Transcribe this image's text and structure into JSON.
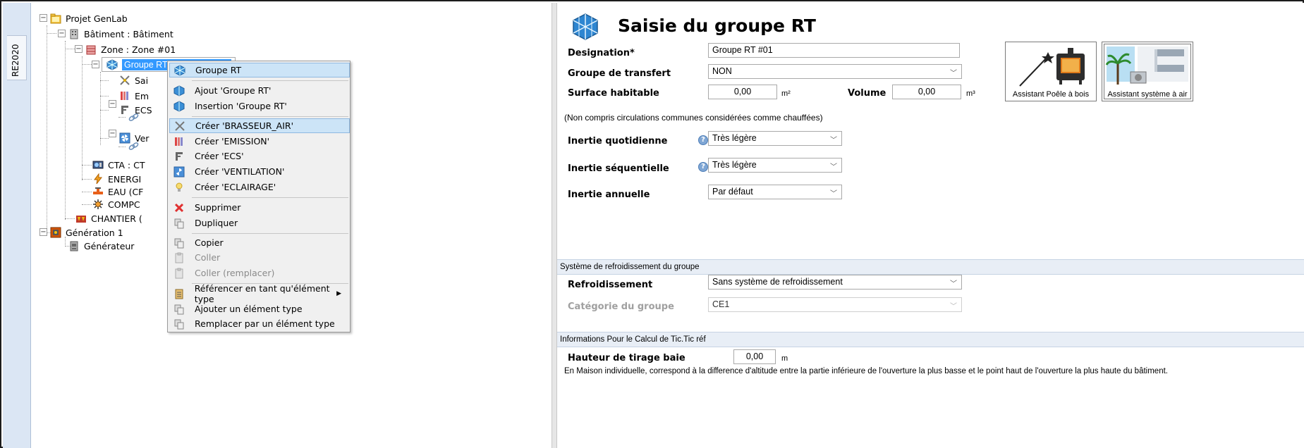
{
  "side_tab": {
    "label": "RE2020"
  },
  "tree": {
    "nodes": [
      {
        "label": "Projet GenLab",
        "icon": "folder-project-icon"
      },
      {
        "label": "Bâtiment : Bâtiment",
        "icon": "building-icon"
      },
      {
        "label": "Zone : Zone #01",
        "icon": "zone-icon"
      },
      {
        "label": "Groupe RT:Groupe RT #01",
        "icon": "groupe-rt-icon"
      },
      {
        "label": "Sai",
        "icon": "brasseur-icon"
      },
      {
        "label": "Em",
        "icon": "emission-icon"
      },
      {
        "label": "ECS",
        "icon": "ecs-icon"
      },
      {
        "label": "Ver",
        "icon": "ventilation-icon"
      },
      {
        "label": "CTA : CT",
        "icon": "cta-icon"
      },
      {
        "label": "ENERGI",
        "icon": "energy-icon"
      },
      {
        "label": "EAU (CF",
        "icon": "water-icon"
      },
      {
        "label": "COMPC",
        "icon": "component-icon"
      },
      {
        "label": "CHANTIER (",
        "icon": "chantier-icon"
      },
      {
        "label": "Génération 1",
        "icon": "generation-icon"
      },
      {
        "label": "Générateur",
        "icon": "generator-icon"
      }
    ]
  },
  "context_menu": {
    "items": [
      {
        "label": "Groupe RT",
        "icon": "groupe-rt-icon"
      },
      {
        "label": "Ajout 'Groupe RT'",
        "icon": "groupe-rt-icon"
      },
      {
        "label": "Insertion 'Groupe RT'",
        "icon": "groupe-rt-icon"
      },
      {
        "label": "Créer 'BRASSEUR_AIR'",
        "icon": "brasseur-icon"
      },
      {
        "label": "Créer 'EMISSION'",
        "icon": "emission-icon"
      },
      {
        "label": "Créer 'ECS'",
        "icon": "ecs-icon"
      },
      {
        "label": "Créer 'VENTILATION'",
        "icon": "ventilation-icon"
      },
      {
        "label": "Créer 'ECLAIRAGE'",
        "icon": "lightbulb-icon"
      },
      {
        "label": "Supprimer",
        "icon": "delete-icon"
      },
      {
        "label": "Dupliquer",
        "icon": "duplicate-icon"
      },
      {
        "label": "Copier",
        "icon": "copy-icon"
      },
      {
        "label": "Coller",
        "icon": "paste-icon"
      },
      {
        "label": "Coller (remplacer)",
        "icon": "paste-replace-icon"
      },
      {
        "label": "Référencer en tant qu'élément type",
        "icon": "reference-icon"
      },
      {
        "label": "Ajouter un élément type",
        "icon": "add-type-icon"
      },
      {
        "label": "Remplacer par un élément type",
        "icon": "replace-type-icon"
      }
    ]
  },
  "form": {
    "title": "Saisie du groupe RT",
    "designation_label": "Designation*",
    "designation_value": "Groupe RT #01",
    "groupe_transfert_label": "Groupe de transfert",
    "groupe_transfert_value": "NON",
    "surface_label": "Surface habitable",
    "surface_value": "0,00",
    "surface_unit": "m²",
    "volume_label": "Volume",
    "volume_value": "0,00",
    "volume_unit": "m³",
    "note": "(Non compris circulations communes considérées comme chauffées)",
    "inertie_quotidienne_label": "Inertie quotidienne",
    "inertie_quotidienne_value": "Très légère",
    "inertie_sequentielle_label": "Inertie séquentielle",
    "inertie_sequentielle_value": "Très légère",
    "inertie_annuelle_label": "Inertie annuelle",
    "inertie_annuelle_value": "Par défaut",
    "assistant_poele_label": "Assistant Poêle à bois",
    "assistant_air_label": "Assistant système à air",
    "section_refroidissement": "Système de refroidissement du groupe",
    "refroidissement_label": "Refroidissement",
    "refroidissement_value": "Sans système de refroidissement",
    "categorie_label": "Catégorie du groupe",
    "categorie_value": "CE1",
    "section_tic": "Informations Pour le Calcul de Tic.Tic réf",
    "hauteur_label": "Hauteur de tirage baie",
    "hauteur_value": "0,00",
    "hauteur_unit": "m",
    "hauteur_note": "En Maison individuelle, correspond à la difference d'altitude entre la partie inférieure de l'ouverture la plus basse et le point haut de l'ouverture la plus haute du bâtiment."
  },
  "colors": {
    "selection": "#3399ff",
    "menu_highlight": "#cce4f7",
    "section_bar": "#e8eef6",
    "side_strip": "#dbe6f4"
  }
}
